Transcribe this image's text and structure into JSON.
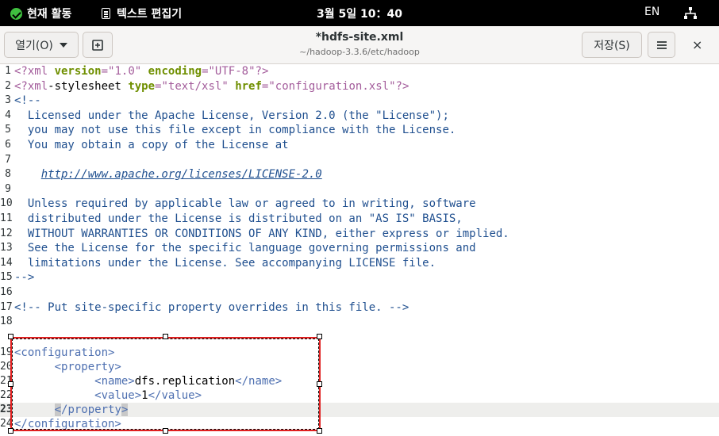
{
  "topbar": {
    "activities_label": "현재 활동",
    "app_label": "텍스트 편집기",
    "clock": "3월 5일  10：40",
    "lang": "EN"
  },
  "header": {
    "open_label": "열기(O)",
    "title": "*hdfs-site.xml",
    "subtitle": "~/hadoop-3.3.6/etc/hadoop",
    "save_label": "저장(S)",
    "close_glyph": "×",
    "menu_glyph": "≡"
  },
  "editor": {
    "current_line": 23,
    "lines": [
      {
        "n": "1",
        "segs": [
          [
            "pi",
            "<?xml "
          ],
          [
            "attr",
            "version"
          ],
          [
            "punc",
            "="
          ],
          [
            "val",
            "\"1.0\""
          ],
          [
            "text",
            " "
          ],
          [
            "attr",
            "encoding"
          ],
          [
            "punc",
            "="
          ],
          [
            "val",
            "\"UTF-8\""
          ],
          [
            "pi",
            "?>"
          ]
        ]
      },
      {
        "n": "2",
        "segs": [
          [
            "pi",
            "<?xml"
          ],
          [
            "text",
            "-stylesheet "
          ],
          [
            "attr",
            "type"
          ],
          [
            "punc",
            "="
          ],
          [
            "val",
            "\"text/xsl\""
          ],
          [
            "text",
            " "
          ],
          [
            "attr",
            "href"
          ],
          [
            "punc",
            "="
          ],
          [
            "val",
            "\"configuration.xsl\""
          ],
          [
            "pi",
            "?>"
          ]
        ]
      },
      {
        "n": "3",
        "segs": [
          [
            "com",
            "<!--"
          ]
        ]
      },
      {
        "n": "4",
        "segs": [
          [
            "com",
            "  Licensed under the Apache License, Version 2.0 (the \"License\");"
          ]
        ]
      },
      {
        "n": "5",
        "segs": [
          [
            "com",
            "  you may not use this file except in compliance with the License."
          ]
        ]
      },
      {
        "n": "6",
        "segs": [
          [
            "com",
            "  You may obtain a copy of the License at"
          ]
        ]
      },
      {
        "n": "7",
        "segs": []
      },
      {
        "n": "8",
        "segs": [
          [
            "com",
            "    "
          ],
          [
            "url",
            "http://www.apache.org/licenses/LICENSE-2.0"
          ]
        ]
      },
      {
        "n": "9",
        "segs": []
      },
      {
        "n": "10",
        "segs": [
          [
            "com",
            "  Unless required by applicable law or agreed to in writing, software"
          ]
        ]
      },
      {
        "n": "11",
        "segs": [
          [
            "com",
            "  distributed under the License is distributed on an \"AS IS\" BASIS,"
          ]
        ]
      },
      {
        "n": "12",
        "segs": [
          [
            "com",
            "  WITHOUT WARRANTIES OR CONDITIONS OF ANY KIND, either express or implied."
          ]
        ]
      },
      {
        "n": "13",
        "segs": [
          [
            "com",
            "  See the License for the specific language governing permissions and"
          ]
        ]
      },
      {
        "n": "14",
        "segs": [
          [
            "com",
            "  limitations under the License. See accompanying LICENSE file."
          ]
        ]
      },
      {
        "n": "15",
        "segs": [
          [
            "com",
            "-->"
          ]
        ]
      },
      {
        "n": "16",
        "segs": []
      },
      {
        "n": "17",
        "segs": [
          [
            "com",
            "<!-- Put site-specific property overrides in this file. -->"
          ]
        ]
      },
      {
        "n": "18",
        "segs": []
      },
      {
        "n": "19",
        "segs": [
          [
            "tag",
            "<configuration>"
          ]
        ]
      },
      {
        "n": "20",
        "segs": [
          [
            "text",
            "      "
          ],
          [
            "tag",
            "<property>"
          ]
        ]
      },
      {
        "n": "21",
        "segs": [
          [
            "text",
            "            "
          ],
          [
            "tag",
            "<name>"
          ],
          [
            "text",
            "dfs.replication"
          ],
          [
            "tag",
            "</name>"
          ]
        ]
      },
      {
        "n": "22",
        "segs": [
          [
            "text",
            "            "
          ],
          [
            "tag",
            "<value>"
          ],
          [
            "text",
            "1"
          ],
          [
            "tag",
            "</value>"
          ]
        ]
      },
      {
        "n": "23",
        "segs": [
          [
            "text",
            "      "
          ],
          [
            "br",
            "<"
          ],
          [
            "tag",
            "/property"
          ],
          [
            "br",
            ">"
          ]
        ]
      },
      {
        "n": "24",
        "segs": [
          [
            "tag",
            "</configuration>"
          ]
        ]
      }
    ]
  },
  "colors": {
    "selection_border": "#e02020",
    "current_line_bg": "#eeeeec"
  }
}
